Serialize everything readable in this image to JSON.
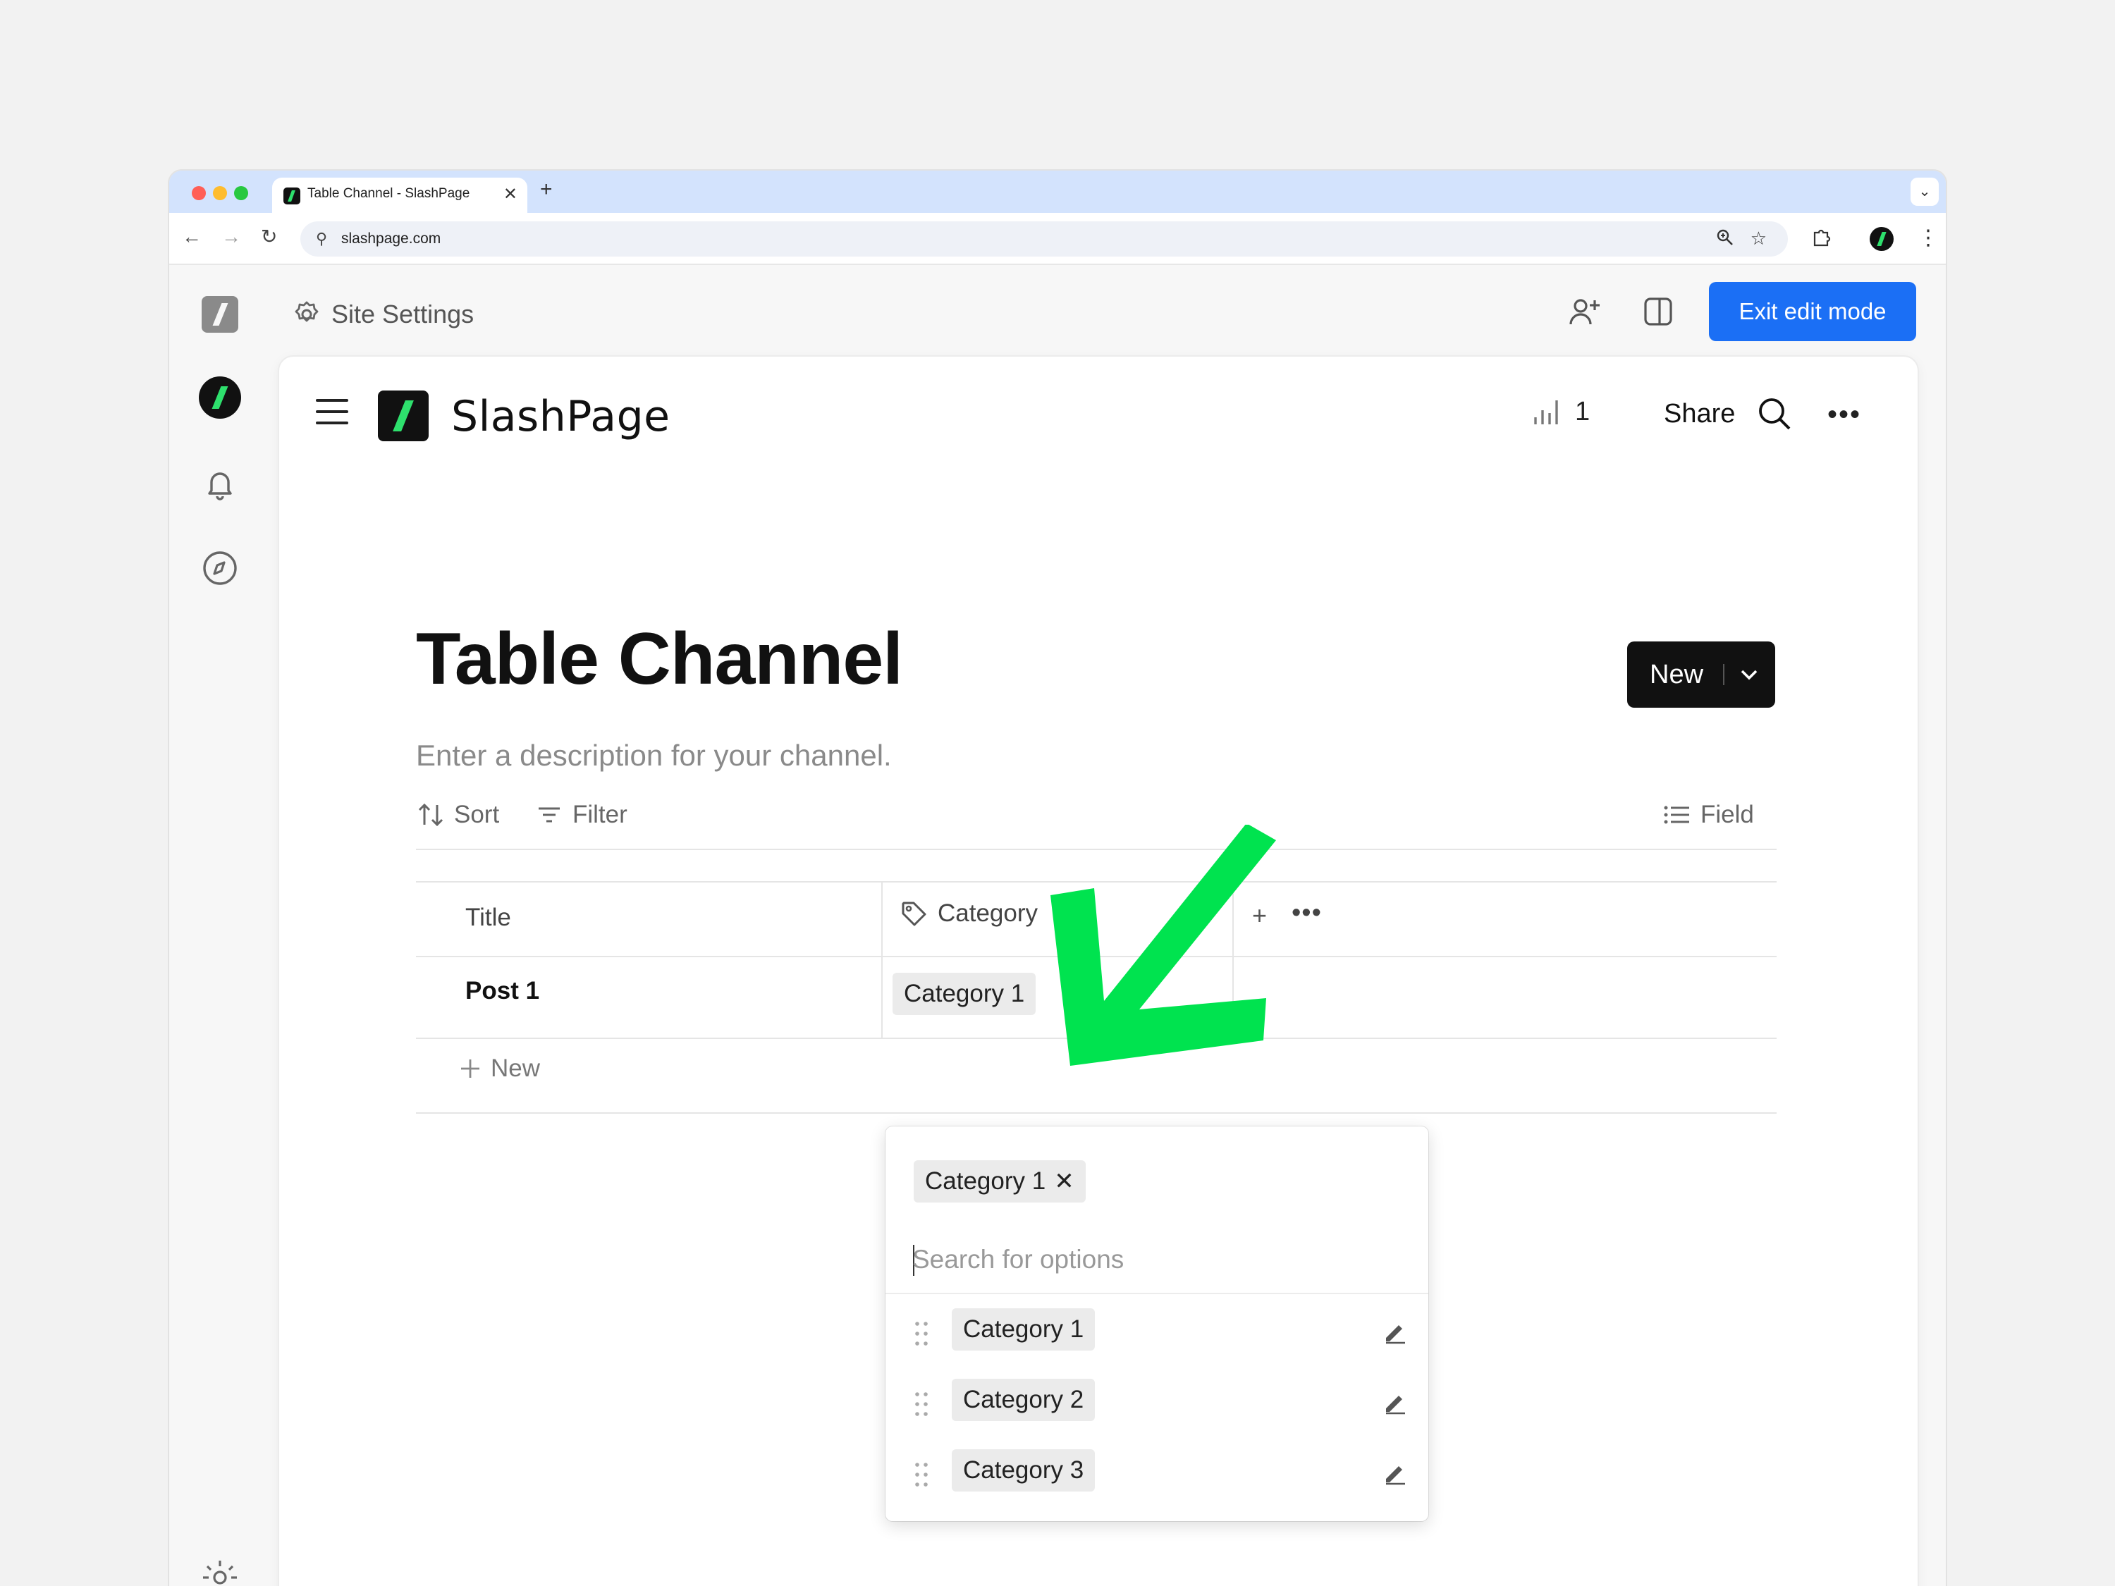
{
  "browser": {
    "tab_title": "Table Channel - SlashPage",
    "tab_close": "✕",
    "new_tab": "+",
    "url": "slashpage.com"
  },
  "app": {
    "site_settings_label": "Site Settings",
    "exit_edit_label": "Exit edit mode",
    "accent_color": "#1b6ff5",
    "brand_green": "#2ee06d"
  },
  "header": {
    "brand_name": "SlashPage",
    "stats_count": "1",
    "share_label": "Share"
  },
  "channel": {
    "title": "Table Channel",
    "description_placeholder": "Enter a description for your channel.",
    "new_button_label": "New"
  },
  "toolbar": {
    "sort_label": "Sort",
    "filter_label": "Filter",
    "field_label": "Field"
  },
  "table": {
    "columns": [
      "Title",
      "Category"
    ],
    "rows": [
      {
        "title": "Post 1",
        "category": "Category 1"
      }
    ],
    "add_row_label": "New"
  },
  "dropdown": {
    "selected": "Category 1",
    "search_placeholder": "Search for options",
    "options": [
      "Category 1",
      "Category 2",
      "Category 3"
    ]
  },
  "annotation": {
    "arrow_color": "#00e34f"
  }
}
